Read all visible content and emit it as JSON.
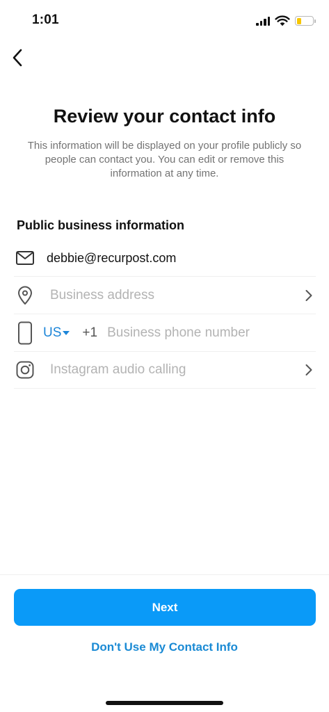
{
  "status_bar": {
    "time": "1:01"
  },
  "header": {
    "title": "Review your contact info",
    "subtitle": "This information will be displayed on your profile publicly so people can contact you. You can edit or remove this information at any time."
  },
  "section": {
    "heading": "Public business information"
  },
  "fields": {
    "email": {
      "value": "debbie@recurpost.com"
    },
    "address": {
      "placeholder": "Business address"
    },
    "phone": {
      "country": "US",
      "dial_code": "+1",
      "placeholder": "Business phone number"
    },
    "audio_calling": {
      "placeholder": "Instagram audio calling"
    }
  },
  "actions": {
    "next_label": "Next",
    "skip_label": "Don't Use My Contact Info"
  },
  "colors": {
    "primary_button": "#0a9af8",
    "link": "#1a8ad4",
    "battery": "#f7c600"
  }
}
